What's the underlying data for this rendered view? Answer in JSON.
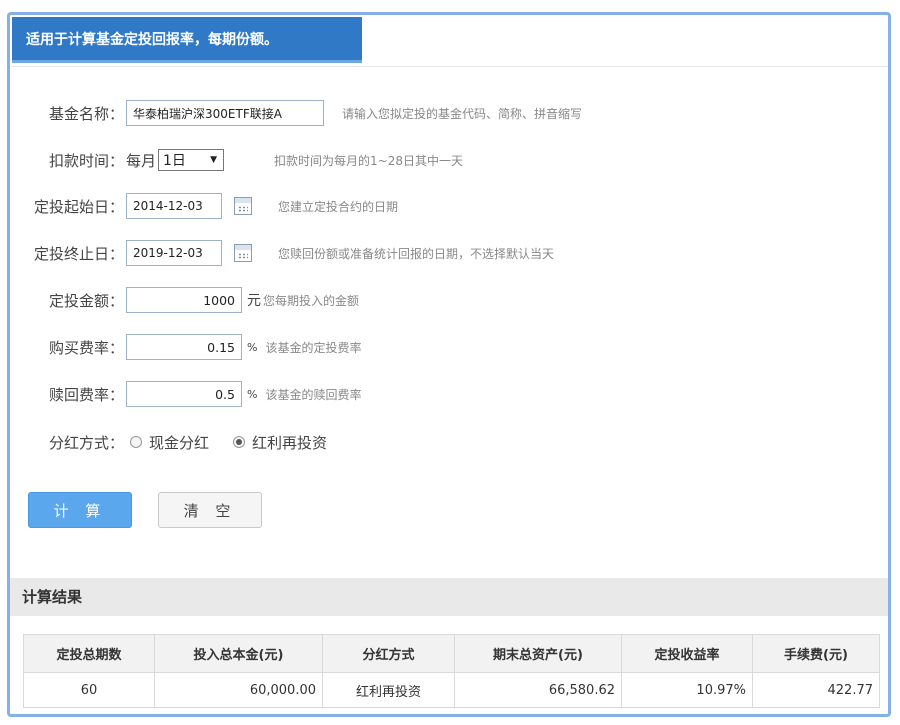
{
  "header": {
    "title": "适用于计算基金定投回报率，每期份额。"
  },
  "form": {
    "fund_name": {
      "label": "基金名称：",
      "value": "华泰柏瑞沪深300ETF联接A",
      "hint": "请输入您拟定投的基金代码、简称、拼音缩写"
    },
    "debit_time": {
      "label": "扣款时间：",
      "prefix": "每月",
      "selected": "1日",
      "hint": "扣款时间为每月的1~28日其中一天"
    },
    "start_date": {
      "label": "定投起始日：",
      "value": "2014-12-03",
      "hint": "您建立定投合约的日期"
    },
    "end_date": {
      "label": "定投终止日：",
      "value": "2019-12-03",
      "hint": "您赎回份额或准备统计回报的日期，不选择默认当天"
    },
    "amount": {
      "label": "定投金额：",
      "value": "1000",
      "unit": "元",
      "hint": "您每期投入的金额"
    },
    "purchase_fee": {
      "label": "购买费率：",
      "value": "0.15",
      "unit": "%",
      "hint": "该基金的定投费率"
    },
    "redeem_fee": {
      "label": "赎回费率：",
      "value": "0.5",
      "unit": "%",
      "hint": "该基金的赎回费率"
    },
    "dividend": {
      "label": "分红方式：",
      "options": [
        "现金分红",
        "红利再投资"
      ],
      "selected_index": 1
    }
  },
  "buttons": {
    "calculate": "计 算",
    "clear": "清 空"
  },
  "results": {
    "title": "计算结果",
    "columns": [
      "定投总期数",
      "投入总本金(元)",
      "分红方式",
      "期末总资产(元)",
      "定投收益率",
      "手续费(元)"
    ],
    "row": [
      "60",
      "60,000.00",
      "红利再投资",
      "66,580.62",
      "10.97%",
      "422.77"
    ]
  },
  "colors": {
    "accent": "#2f79c6",
    "button_primary": "#5aa7ee",
    "return_rate": "#e0282e"
  }
}
